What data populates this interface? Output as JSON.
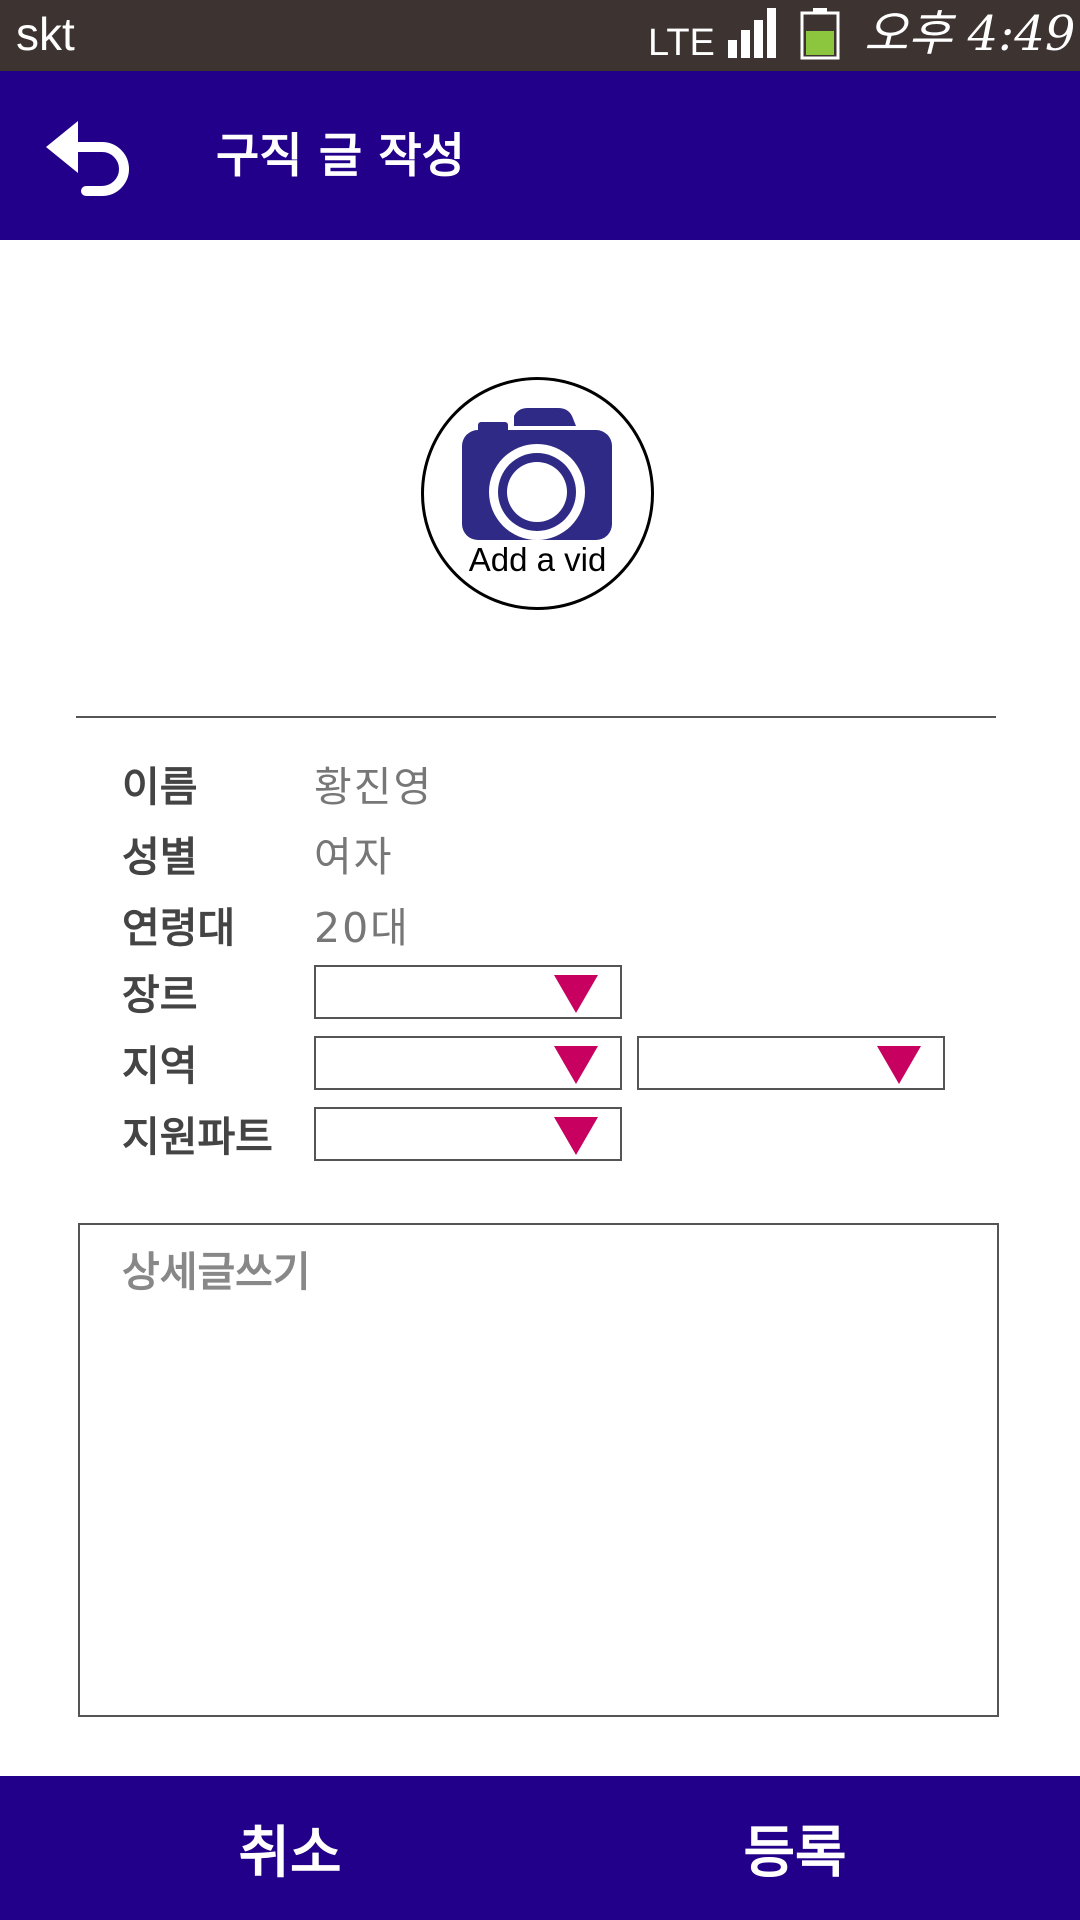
{
  "status_bar": {
    "carrier": "skt",
    "network": "LTE",
    "time": "오후 4:49",
    "icons": [
      "signal-icon",
      "battery-icon"
    ],
    "battery_color": "#8cc63f"
  },
  "app_bar": {
    "back_icon": "back-arrow-icon",
    "title": "구직 글 작성",
    "background": "#22008a"
  },
  "media": {
    "icon": "camera-icon",
    "label": "Add a vid",
    "icon_color": "#2e2a85"
  },
  "form": {
    "fields": [
      {
        "label": "이름",
        "value": "황진영"
      },
      {
        "label": "성별",
        "value": "여자"
      },
      {
        "label": "연령대",
        "value": "20대"
      },
      {
        "label": "장르",
        "value": ""
      },
      {
        "label": "지역",
        "value": ""
      },
      {
        "label": "지원파트",
        "value": ""
      }
    ],
    "dropdown_arrow_color": "#c8005f"
  },
  "detail": {
    "placeholder": "상세글쓰기"
  },
  "actions": {
    "cancel_label": "취소",
    "submit_label": "등록"
  }
}
